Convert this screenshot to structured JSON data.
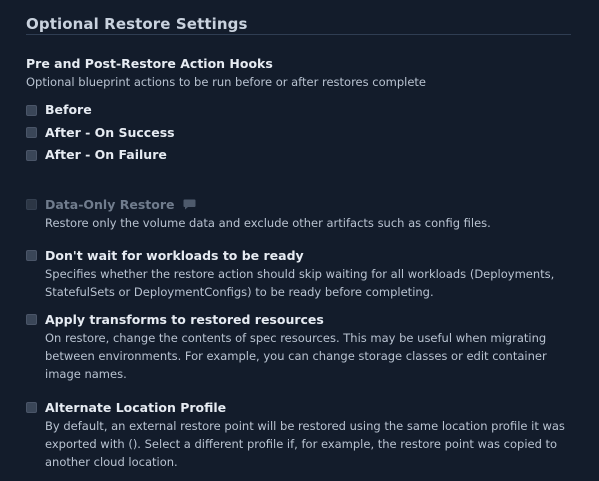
{
  "panel": {
    "title": "Optional Restore Settings"
  },
  "hooks": {
    "heading": "Pre and Post-Restore Action Hooks",
    "description": "Optional blueprint actions to be run before or after restores complete",
    "items": [
      {
        "label": "Before",
        "checked": false
      },
      {
        "label": "After - On Success",
        "checked": false
      },
      {
        "label": "After - On Failure",
        "checked": false
      }
    ]
  },
  "options": {
    "data_only": {
      "label": "Data-Only Restore",
      "description": "Restore only the volume data and exclude other artifacts such as config files.",
      "disabled": true,
      "icon": "comment-icon"
    },
    "dont_wait": {
      "label": "Don't wait for workloads to be ready",
      "description": "Specifies whether the restore action should skip waiting for all workloads (Deployments, StatefulSets or DeploymentConfigs) to be ready before completing."
    },
    "transforms": {
      "label": "Apply transforms to restored resources",
      "description": "On restore, change the contents of spec resources. This may be useful when migrating between environments. For example, you can change storage classes or edit container image names."
    },
    "alt_location": {
      "label": "Alternate Location Profile",
      "description": "By default, an external restore point will be restored using the same location profile it was exported with (). Select a different profile if, for example, the restore point was copied to another cloud location."
    }
  },
  "colors": {
    "background": "#131c2b",
    "text": "#e6ebf2",
    "muted_text": "#b9c3d1",
    "disabled_text": "#707c8d",
    "checkbox": "#3a4658"
  }
}
